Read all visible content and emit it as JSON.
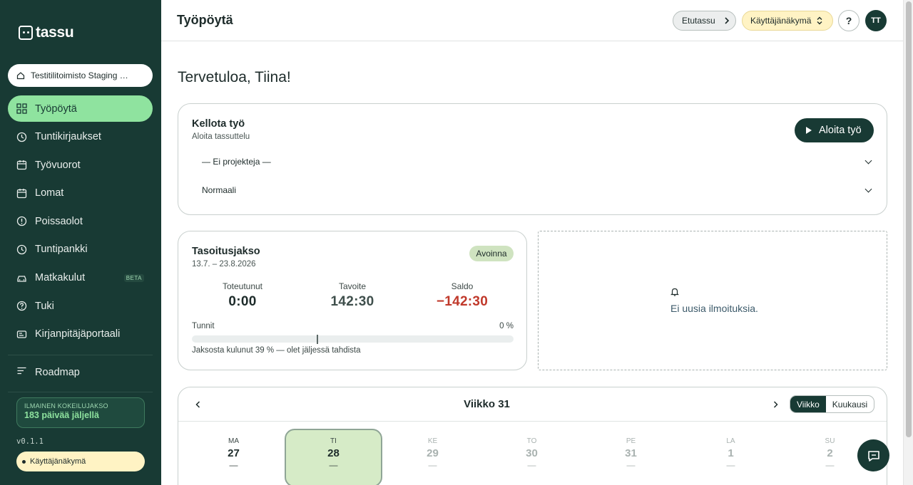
{
  "sidebar": {
    "logo": "tassu",
    "org": "Testitilitoimisto Staging Oy",
    "items": [
      {
        "label": "Työpöytä",
        "icon": "grid-icon"
      },
      {
        "label": "Tuntikirjaukset",
        "icon": "clock-icon"
      },
      {
        "label": "Työvuorot",
        "icon": "calendar-icon"
      },
      {
        "label": "Lomat",
        "icon": "calendar-icon"
      },
      {
        "label": "Poissaolot",
        "icon": "alert-circle-icon"
      },
      {
        "label": "Tuntipankki",
        "icon": "clock-icon"
      },
      {
        "label": "Matkakulut",
        "icon": "car-icon",
        "badge": "BETA"
      },
      {
        "label": "Tuki",
        "icon": "help-circle-icon"
      },
      {
        "label": "Kirjanpitäjäportaali",
        "icon": "id-card-icon"
      }
    ],
    "roadmap": "Roadmap",
    "trial_title": "ILMAINEN KOKEILUJAKSO",
    "trial_days": "183 päivää jäljellä",
    "version": "v0.1.1",
    "view_label": "Käyttäjänäkymä"
  },
  "header": {
    "title": "Työpöytä",
    "etutassu": "Etutassu",
    "view": "Käyttäjänäkymä",
    "help": "?",
    "avatar": "TT"
  },
  "main": {
    "greeting": "Tervetuloa, Tiina!",
    "clock": {
      "title": "Kellota työ",
      "subtitle": "Aloita tassuttelu",
      "start_button": "Aloita työ",
      "project": "— Ei projekteja —",
      "type": "Normaali"
    },
    "period": {
      "title": "Tasoitusjakso",
      "range": "13.7. – 23.8.2026",
      "status": "Avoinna",
      "done_label": "Toteutunut",
      "done_value": "0:00",
      "target_label": "Tavoite",
      "target_value": "142:30",
      "balance_label": "Saldo",
      "balance_value": "−142:30",
      "hours_label": "Tunnit",
      "percent": "0 %",
      "progress": 0,
      "elapsed_marker": 0.39,
      "note": "Jaksosta kulunut 39 % — olet jäljessä tahdista"
    },
    "notifications": {
      "empty": "Ei uusia ilmoituksia."
    },
    "week": {
      "title": "Viikko 31",
      "view_week": "Viikko",
      "view_month": "Kuukausi",
      "days": [
        {
          "name": "MA",
          "date": "27",
          "sum": "—"
        },
        {
          "name": "TI",
          "date": "28",
          "sum": "—"
        },
        {
          "name": "KE",
          "date": "29",
          "sum": "—"
        },
        {
          "name": "TO",
          "date": "30",
          "sum": "—"
        },
        {
          "name": "PE",
          "date": "31",
          "sum": "—"
        },
        {
          "name": "LA",
          "date": "1",
          "sum": "—"
        },
        {
          "name": "SU",
          "date": "2",
          "sum": "—"
        }
      ]
    }
  },
  "colors": {
    "sidebar_bg": "#183a34",
    "accent": "#8fe39f",
    "negative": "#c0392b",
    "view_bg": "#fff3c4"
  }
}
